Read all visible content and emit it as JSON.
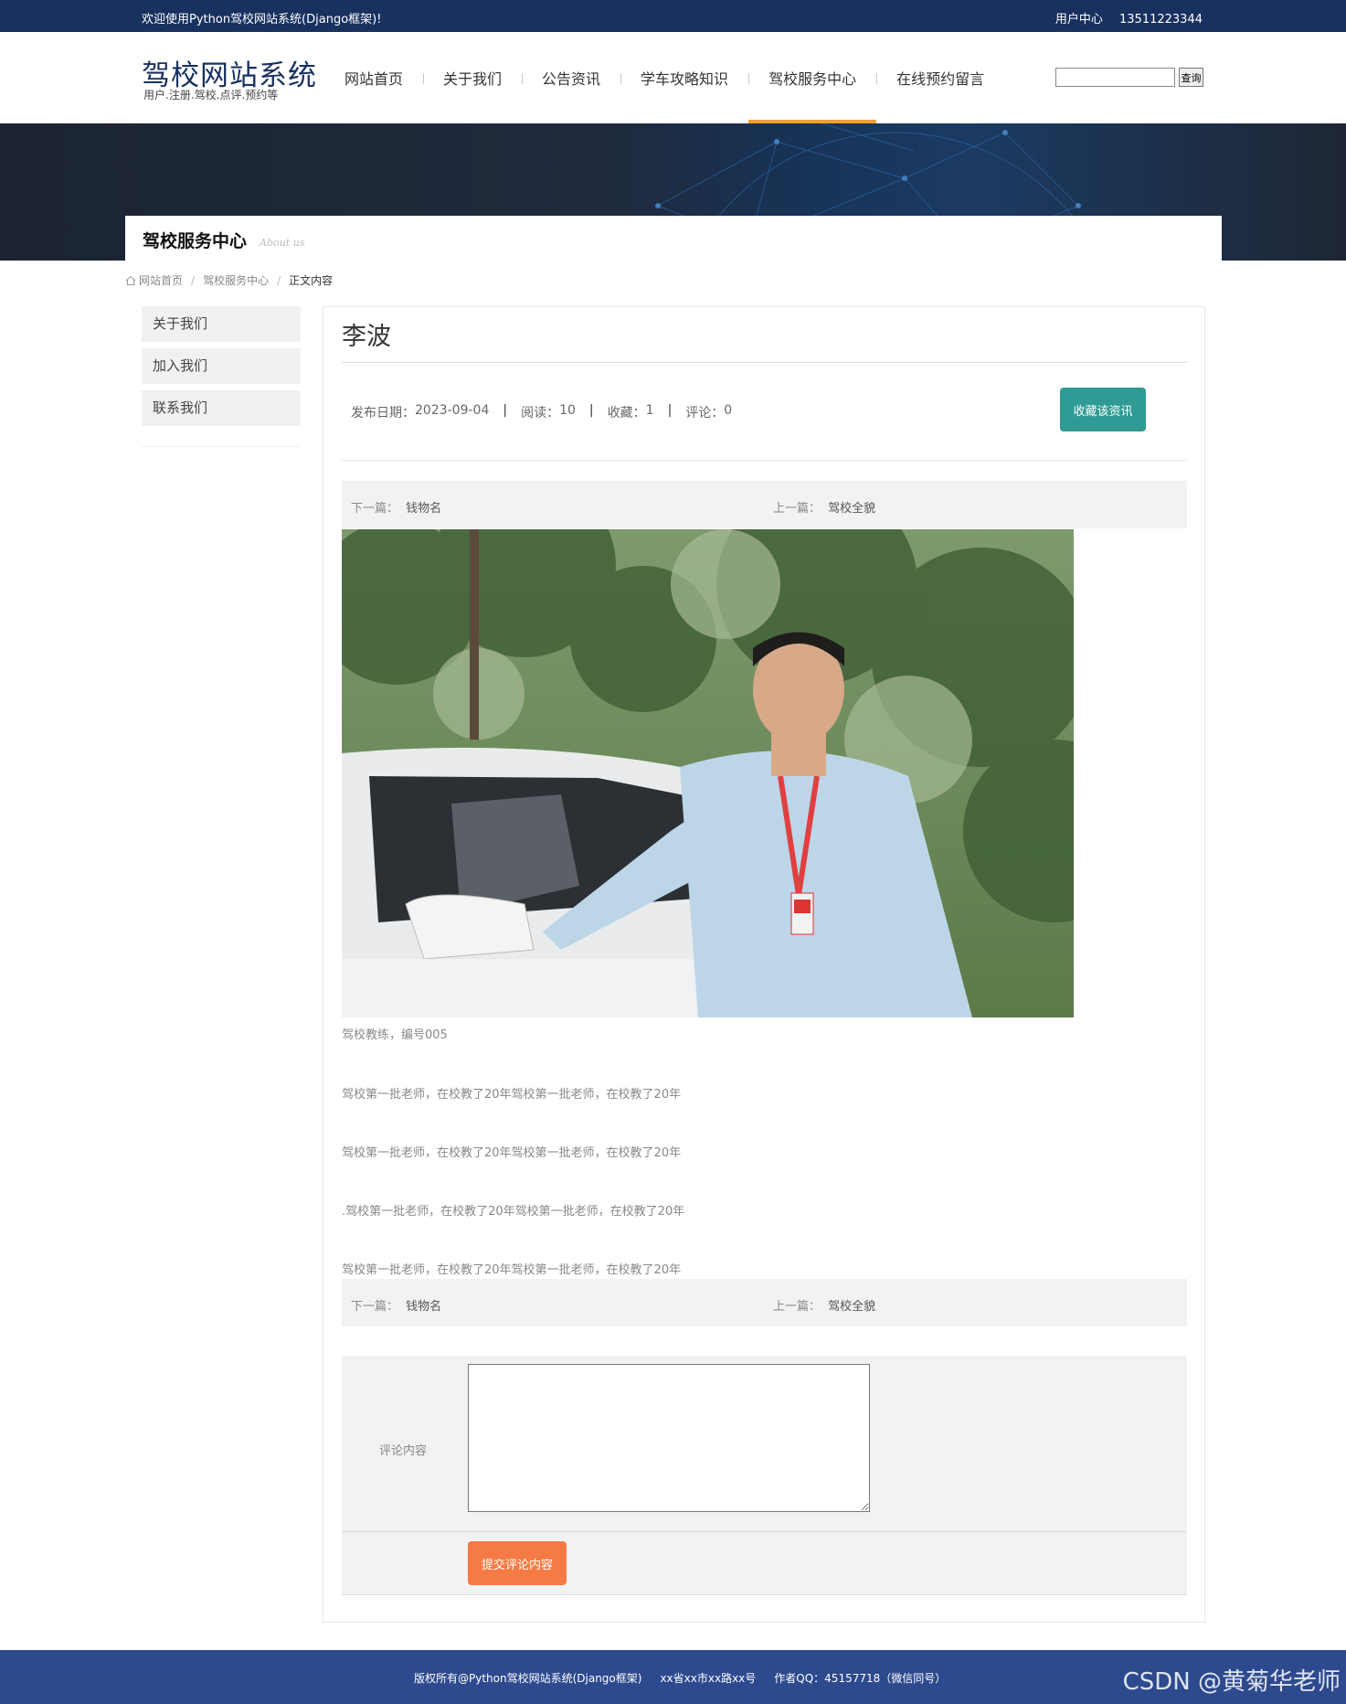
{
  "topbar": {
    "welcome": "欢迎使用Python驾校网站系统(Django框架)!",
    "user_center": "用户中心",
    "phone": "13511223344"
  },
  "header": {
    "logo_title": "驾校网站系统",
    "logo_subtitle": "用户.注册.驾校.点评.预约等",
    "nav": [
      "网站首页",
      "关于我们",
      "公告资讯",
      "学车攻略知识",
      "驾校服务中心",
      "在线预约留言"
    ],
    "active_nav": "驾校服务中心",
    "search_placeholder": "",
    "search_button": "查询"
  },
  "banner": {
    "section_title": "驾校服务中心",
    "section_subtitle": "About us"
  },
  "breadcrumb": {
    "home": "网站首页",
    "section": "驾校服务中心",
    "current": "正文内容"
  },
  "sidebar": {
    "items": [
      "关于我们",
      "加入我们",
      "联系我们"
    ]
  },
  "article": {
    "title": "李波",
    "date_label": "发布日期：",
    "date": "2023-09-04",
    "read_label": "阅读：",
    "read": "10",
    "fav_label": "收藏：",
    "fav": "1",
    "comment_label": "评论：",
    "comment": "0",
    "fav_button": "收藏该资讯",
    "next_label": "下一篇：",
    "next_title": "钱物名",
    "prev_label": "上一篇：",
    "prev_title": "驾校全貌",
    "caption": "驾校教练，编号005",
    "paragraphs": [
      "驾校第一批老师，在校教了20年驾校第一批老师，在校教了20年",
      "驾校第一批老师，在校教了20年驾校第一批老师，在校教了20年",
      ".驾校第一批老师，在校教了20年驾校第一批老师，在校教了20年",
      "驾校第一批老师，在校教了20年驾校第一批老师，在校教了20年"
    ]
  },
  "comment_form": {
    "label": "评论内容",
    "value": "",
    "submit": "提交评论内容"
  },
  "footer": {
    "copyright": "版权所有@Python驾校网站系统(Django框架)",
    "address": "xx省xx市xx路xx号",
    "author": "作者QQ：45157718（微信同号）",
    "watermark": "CSDN @黄菊华老师"
  },
  "colors": {
    "topbar": "#18315f",
    "accent_nav": "#f0a22e",
    "fav_button": "#2f9b94",
    "submit_button": "#f67a44",
    "footer": "#2d4a8f"
  }
}
